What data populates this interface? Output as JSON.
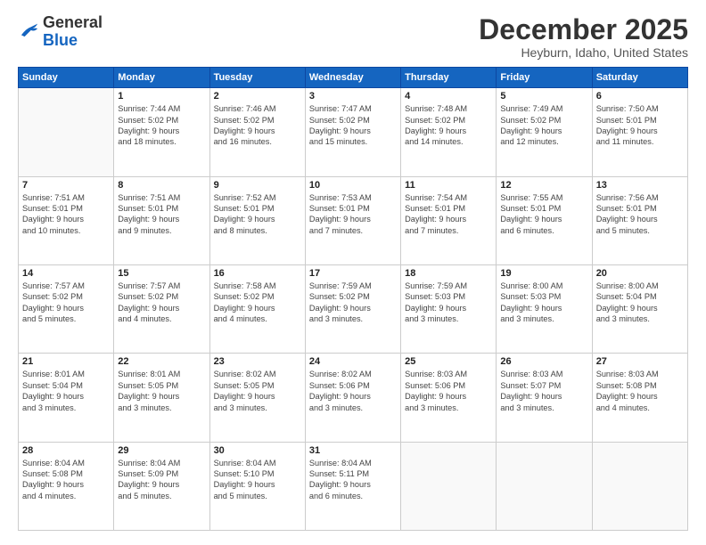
{
  "header": {
    "logo": {
      "line1": "General",
      "line2": "Blue"
    },
    "title": "December 2025",
    "subtitle": "Heyburn, Idaho, United States"
  },
  "weekdays": [
    "Sunday",
    "Monday",
    "Tuesday",
    "Wednesday",
    "Thursday",
    "Friday",
    "Saturday"
  ],
  "weeks": [
    [
      {
        "day": "",
        "info": ""
      },
      {
        "day": "1",
        "info": "Sunrise: 7:44 AM\nSunset: 5:02 PM\nDaylight: 9 hours\nand 18 minutes."
      },
      {
        "day": "2",
        "info": "Sunrise: 7:46 AM\nSunset: 5:02 PM\nDaylight: 9 hours\nand 16 minutes."
      },
      {
        "day": "3",
        "info": "Sunrise: 7:47 AM\nSunset: 5:02 PM\nDaylight: 9 hours\nand 15 minutes."
      },
      {
        "day": "4",
        "info": "Sunrise: 7:48 AM\nSunset: 5:02 PM\nDaylight: 9 hours\nand 14 minutes."
      },
      {
        "day": "5",
        "info": "Sunrise: 7:49 AM\nSunset: 5:02 PM\nDaylight: 9 hours\nand 12 minutes."
      },
      {
        "day": "6",
        "info": "Sunrise: 7:50 AM\nSunset: 5:01 PM\nDaylight: 9 hours\nand 11 minutes."
      }
    ],
    [
      {
        "day": "7",
        "info": "Sunrise: 7:51 AM\nSunset: 5:01 PM\nDaylight: 9 hours\nand 10 minutes."
      },
      {
        "day": "8",
        "info": "Sunrise: 7:51 AM\nSunset: 5:01 PM\nDaylight: 9 hours\nand 9 minutes."
      },
      {
        "day": "9",
        "info": "Sunrise: 7:52 AM\nSunset: 5:01 PM\nDaylight: 9 hours\nand 8 minutes."
      },
      {
        "day": "10",
        "info": "Sunrise: 7:53 AM\nSunset: 5:01 PM\nDaylight: 9 hours\nand 7 minutes."
      },
      {
        "day": "11",
        "info": "Sunrise: 7:54 AM\nSunset: 5:01 PM\nDaylight: 9 hours\nand 7 minutes."
      },
      {
        "day": "12",
        "info": "Sunrise: 7:55 AM\nSunset: 5:01 PM\nDaylight: 9 hours\nand 6 minutes."
      },
      {
        "day": "13",
        "info": "Sunrise: 7:56 AM\nSunset: 5:01 PM\nDaylight: 9 hours\nand 5 minutes."
      }
    ],
    [
      {
        "day": "14",
        "info": "Sunrise: 7:57 AM\nSunset: 5:02 PM\nDaylight: 9 hours\nand 5 minutes."
      },
      {
        "day": "15",
        "info": "Sunrise: 7:57 AM\nSunset: 5:02 PM\nDaylight: 9 hours\nand 4 minutes."
      },
      {
        "day": "16",
        "info": "Sunrise: 7:58 AM\nSunset: 5:02 PM\nDaylight: 9 hours\nand 4 minutes."
      },
      {
        "day": "17",
        "info": "Sunrise: 7:59 AM\nSunset: 5:02 PM\nDaylight: 9 hours\nand 3 minutes."
      },
      {
        "day": "18",
        "info": "Sunrise: 7:59 AM\nSunset: 5:03 PM\nDaylight: 9 hours\nand 3 minutes."
      },
      {
        "day": "19",
        "info": "Sunrise: 8:00 AM\nSunset: 5:03 PM\nDaylight: 9 hours\nand 3 minutes."
      },
      {
        "day": "20",
        "info": "Sunrise: 8:00 AM\nSunset: 5:04 PM\nDaylight: 9 hours\nand 3 minutes."
      }
    ],
    [
      {
        "day": "21",
        "info": "Sunrise: 8:01 AM\nSunset: 5:04 PM\nDaylight: 9 hours\nand 3 minutes."
      },
      {
        "day": "22",
        "info": "Sunrise: 8:01 AM\nSunset: 5:05 PM\nDaylight: 9 hours\nand 3 minutes."
      },
      {
        "day": "23",
        "info": "Sunrise: 8:02 AM\nSunset: 5:05 PM\nDaylight: 9 hours\nand 3 minutes."
      },
      {
        "day": "24",
        "info": "Sunrise: 8:02 AM\nSunset: 5:06 PM\nDaylight: 9 hours\nand 3 minutes."
      },
      {
        "day": "25",
        "info": "Sunrise: 8:03 AM\nSunset: 5:06 PM\nDaylight: 9 hours\nand 3 minutes."
      },
      {
        "day": "26",
        "info": "Sunrise: 8:03 AM\nSunset: 5:07 PM\nDaylight: 9 hours\nand 3 minutes."
      },
      {
        "day": "27",
        "info": "Sunrise: 8:03 AM\nSunset: 5:08 PM\nDaylight: 9 hours\nand 4 minutes."
      }
    ],
    [
      {
        "day": "28",
        "info": "Sunrise: 8:04 AM\nSunset: 5:08 PM\nDaylight: 9 hours\nand 4 minutes."
      },
      {
        "day": "29",
        "info": "Sunrise: 8:04 AM\nSunset: 5:09 PM\nDaylight: 9 hours\nand 5 minutes."
      },
      {
        "day": "30",
        "info": "Sunrise: 8:04 AM\nSunset: 5:10 PM\nDaylight: 9 hours\nand 5 minutes."
      },
      {
        "day": "31",
        "info": "Sunrise: 8:04 AM\nSunset: 5:11 PM\nDaylight: 9 hours\nand 6 minutes."
      },
      {
        "day": "",
        "info": ""
      },
      {
        "day": "",
        "info": ""
      },
      {
        "day": "",
        "info": ""
      }
    ]
  ]
}
